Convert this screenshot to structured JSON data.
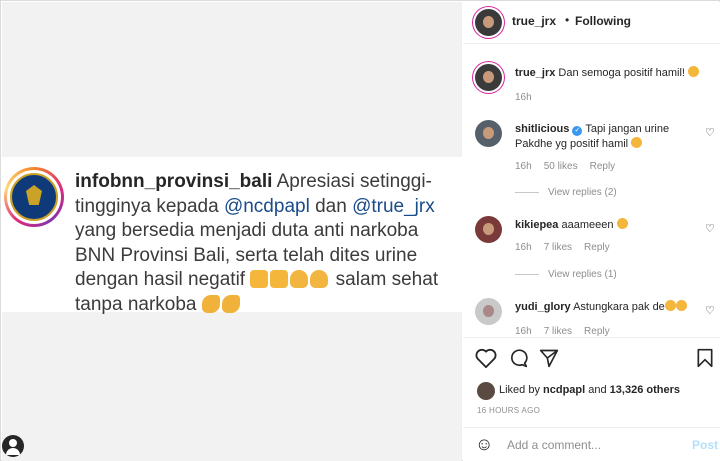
{
  "post": {
    "username": "infobnn_provinsi_bali",
    "caption_1": " Apresiasi setinggi-tingginya kepada ",
    "mention_1": "@ncdpapl",
    "caption_2": " dan ",
    "mention_2": "@true_jrx",
    "caption_3": " yang bersedia menjadi duta anti narkoba BNN Provinsi Bali, serta telah dites urine dengan hasil negatif ",
    "caption_4": " salam sehat tanpa narkoba "
  },
  "header": {
    "username": "true_jrx",
    "separator": "•",
    "follow_status": "Following",
    "more": "···"
  },
  "comments": [
    {
      "username": "true_jrx",
      "text": " Dan semoga positif hamil! ",
      "time": "16h"
    },
    {
      "username": "shitlicious",
      "text": " Tapi jangan urine Pakdhe yg positif hamil ",
      "time": "16h",
      "likes": "50 likes",
      "reply": "Reply",
      "view_replies": "View replies (2)"
    },
    {
      "username": "kikiepea",
      "text": " aaameeen ",
      "time": "16h",
      "likes": "7 likes",
      "reply": "Reply",
      "view_replies": "View replies (1)"
    },
    {
      "username": "yudi_glory",
      "text": " Astungkara pak de",
      "time": "16h",
      "likes": "7 likes",
      "reply": "Reply"
    }
  ],
  "actions": {
    "heart": "♡",
    "comment": "◯",
    "share": "➢",
    "save": "🔖"
  },
  "likes": {
    "prefix": "Liked by ",
    "user": "ncdpapl",
    "middle": " and ",
    "count": "13,326 others"
  },
  "timestamp": "16 HOURS AGO",
  "add_comment": {
    "placeholder": "Add a comment...",
    "post_label": "Post",
    "emoji": "☺"
  },
  "colors": {
    "verified": "#3897f0",
    "mention": "#1a4b8a",
    "post_button_disabled": "#b2dffc"
  }
}
